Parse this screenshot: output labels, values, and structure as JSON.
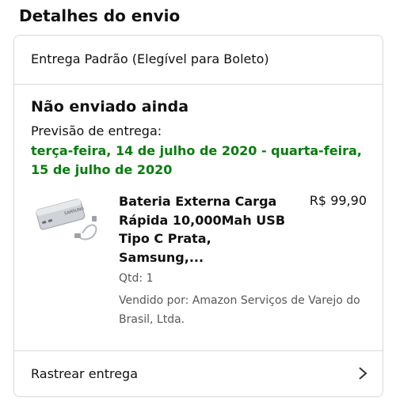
{
  "section_title": "Detalhes do envio",
  "shipping": {
    "method": "Entrega Padrão (Elegível para Boleto)",
    "status": "Não enviado ainda",
    "eta_label": "Previsão de entrega:",
    "eta_value": "terça-feira, 14 de julho de 2020 - quarta-feira, 15 de julho de 2020",
    "eta_color": "#067d0d"
  },
  "product": {
    "title": "Bateria Externa Carga Rápida 10,000Mah USB Tipo C Prata, Samsung,...",
    "price": "R$ 99,90",
    "qty": "Qtd: 1",
    "seller": "Vendido por: Amazon Serviços de Varejo do Brasil, Ltda.",
    "image_icon": "power-bank-image"
  },
  "track": {
    "label": "Rastrear entrega",
    "icon": "chevron-right-icon"
  }
}
